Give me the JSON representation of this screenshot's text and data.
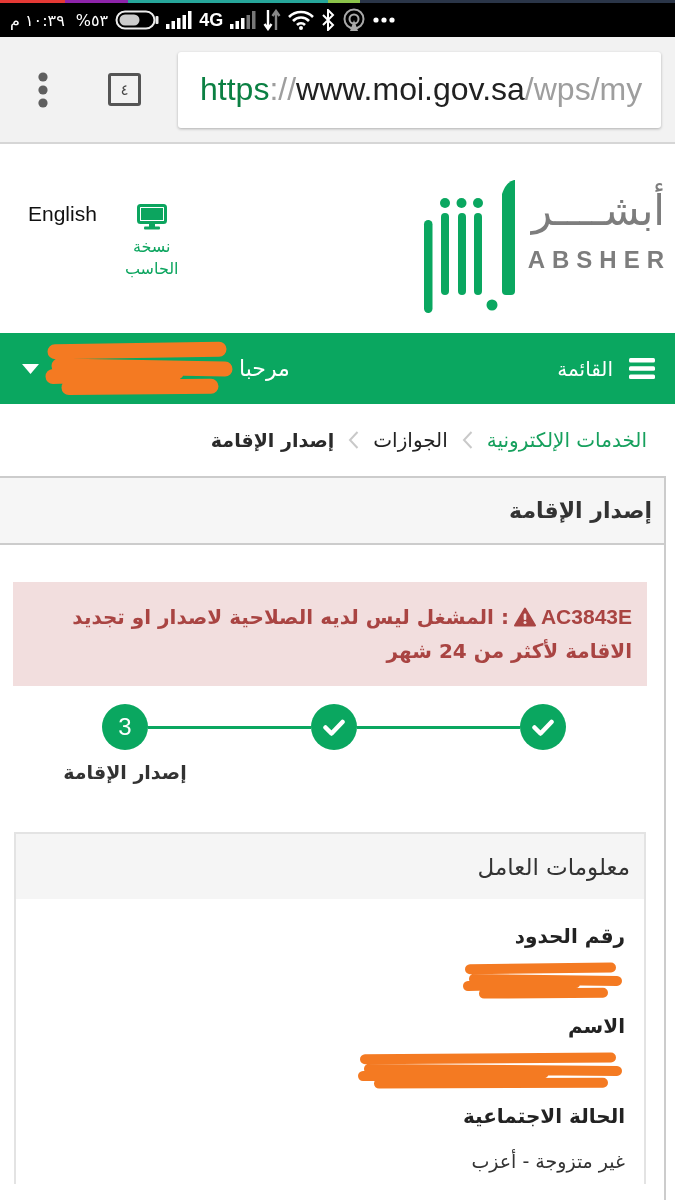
{
  "status_bar": {
    "time": "١٠:٣٩ م",
    "battery": "%٥٣",
    "network": "4G"
  },
  "browser": {
    "tab_count": "٤",
    "url": {
      "scheme": "https",
      "separator": "://",
      "host": "www.moi.gov.sa",
      "path": "/wps/my"
    }
  },
  "header": {
    "language": "English",
    "desktop_version": "نسخة\nالحاسب",
    "logo": {
      "arabic": "أبشــــر",
      "latin": "ABSHER"
    }
  },
  "nav_bar": {
    "menu": "القائمة",
    "greeting": "مرحبا",
    "name_redacted": true
  },
  "breadcrumb": [
    {
      "label": "الخدمات الإلكترونية",
      "kind": "link"
    },
    {
      "label": "الجوازات",
      "kind": "plain"
    },
    {
      "label": "إصدار الإقامة",
      "kind": "current"
    }
  ],
  "panel": {
    "title": "إصدار الإقامة",
    "alert": {
      "code": "AC3843E",
      "message": ": المشغل ليس لديه الصلاحية لاصدار او تجديد الاقامة لأكثر من 24 شهر"
    },
    "steps": [
      {
        "done": true
      },
      {
        "done": true
      },
      {
        "done": false,
        "number": "3",
        "label": "إصدار الإقامة"
      }
    ],
    "worker_info": {
      "title": "معلومات العامل",
      "fields": [
        {
          "label": "رقم الحدود",
          "redacted": true
        },
        {
          "label": "الاسم",
          "redacted": true
        },
        {
          "label": "الحالة الاجتماعية",
          "value": "غير متزوجة - أعزب"
        }
      ]
    }
  }
}
